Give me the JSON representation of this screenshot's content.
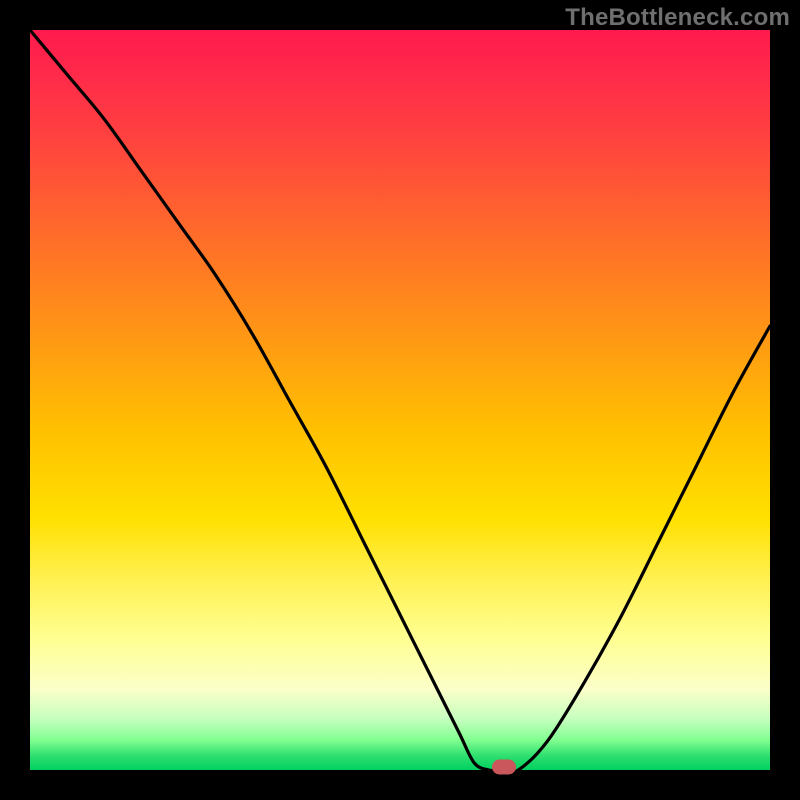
{
  "watermark": "TheBottleneck.com",
  "colors": {
    "frame": "#000000",
    "marker": "#c9575c",
    "curve": "#000000"
  },
  "chart_data": {
    "type": "line",
    "title": "",
    "xlabel": "",
    "ylabel": "",
    "xlim": [
      0,
      100
    ],
    "ylim": [
      0,
      100
    ],
    "grid": false,
    "legend": false,
    "series": [
      {
        "name": "bottleneck-curve",
        "x": [
          0,
          5,
          10,
          15,
          20,
          25,
          30,
          35,
          40,
          45,
          50,
          55,
          58,
          60,
          62,
          64,
          66,
          70,
          75,
          80,
          85,
          90,
          95,
          100
        ],
        "values": [
          100,
          94,
          88,
          81,
          74,
          67,
          59,
          50,
          41,
          31,
          21,
          11,
          5,
          1,
          0,
          0,
          0,
          4,
          12,
          21,
          31,
          41,
          51,
          60
        ]
      }
    ],
    "marker": {
      "x": 64,
      "y": 0
    },
    "flat_segment": {
      "x_start": 58,
      "x_end": 66,
      "y": 0
    }
  }
}
